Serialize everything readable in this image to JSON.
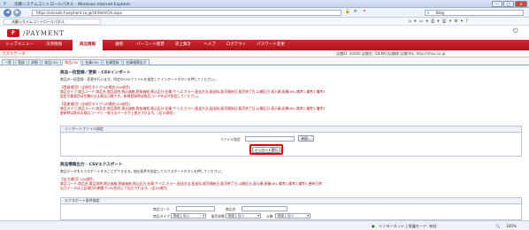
{
  "window": {
    "title": "決算システムコントロールパネル - Windows Internet Explorer",
    "min": "—",
    "max": "□",
    "close": "✕"
  },
  "browser": {
    "back": "◀",
    "forward": "▶",
    "url": "https://console.f-payment.co.jp/ctr/ItemCtlr.aspx",
    "search_engine": "Bing",
    "tab_label": "決算システムコントロールパネル",
    "tool_icons": "⌂ ▾ ▭ ▾ ⎙ ▾ ⓟ ▾ ⚙ ▾ ?"
  },
  "brand": {
    "logo_mark": "F",
    "logo_text": "/PAYMENT",
    "power": "⏻"
  },
  "main_nav": [
    {
      "label": "トップメニュー"
    },
    {
      "label": "決済情報"
    },
    {
      "label": "商品情報"
    },
    {
      "label": "顧客"
    },
    {
      "label": "バーコード帳票"
    },
    {
      "label": "売上集計"
    },
    {
      "label": "ヘルプ"
    },
    {
      "label": "ログアウト"
    },
    {
      "label": "パスワード変更"
    }
  ],
  "page": {
    "subtitle": "ラスクデータ",
    "user_info": "店舗ID: 30000 店舗名: [DEMO]店舗様 店舗URL: http://shou.co.jp"
  },
  "sub_tabs": [
    {
      "label": "一覧"
    },
    {
      "label": "登録"
    },
    {
      "label": "詳細"
    },
    {
      "label": "商品CSV"
    },
    {
      "label": "商品CSV"
    },
    {
      "label": "在庫CSV"
    },
    {
      "label": "在庫登録"
    },
    {
      "label": "在庫帳票出力"
    }
  ],
  "import_section": {
    "title": "商品一括登録／更新 - CSVインポート",
    "desc": "商品の一括登録・変更を行います。所定のCSVファイルを指定してインポートボタンを押してください。",
    "new_title": "【登録項目】(全項目タイプへの場合)(20項目)",
    "new_line1": "商品タイプ,商品コード,商品名,商品説明,税込価格,税抜価格,税込区分,在庫,サイズ,カラー,配送方法,配送料,販売開始日,販売終了日,公開区分,表示順,画像URL,備考1,備考2,備考3",
    "new_line2": "設定不要項目は空欄のまま取込可能です。新規登録時は商品コードを必ず設定してください。",
    "upd_title": "【変更項目】(全項目タイプへの場合)(20項目)",
    "upd_line1": "商品タイプ,商品コード,商品名,商品説明,税込価格,税抜価格,税込区分,在庫,サイズ,カラー,配送方法,配送料,販売開始日,販売終了日,公開区分,表示順,画像URL,備考1,備考2,備考3",
    "upd_line2": "更新時は既存の商品コードと一致するデータが上書きされます。(全10項目)"
  },
  "file_box": {
    "header": "インポートファイル指定",
    "file_label": "ファイル指定",
    "browse": "参照...",
    "import_button": "インポート実行"
  },
  "export_section": {
    "title": "商品情報出力 - CSVエクスポート",
    "desc": "商品データをエクスポートすることができます。抽出条件を指定してエクスポートボタンを押してください。",
    "item_title": "【出力項目】(20項目)",
    "line1": "商品コード,商品名,商品説明,税込価格,税抜価格,税込区分,在庫,サイズ,カラー,配送方法,配送料,販売開始日,販売終了日,公開区分,表示順,画像URL,備考1,備考2,備考3,更新日時",
    "line2": "出力データは上記項目の順番でCSV形式にて出力されます。(全20項目)"
  },
  "export_box": {
    "header": "エクスポート条件指定",
    "code_label": "商品コード",
    "name_label": "商品名",
    "type_label": "商品タイプ",
    "type_value": "指定しない",
    "sale_label": "販売状態",
    "sale_value": "指定しない",
    "pub_label": "公開",
    "pub_value": "指定しない"
  },
  "status": {
    "zone": "インターネット | 保護モード: 有効",
    "zoom": "100%"
  }
}
